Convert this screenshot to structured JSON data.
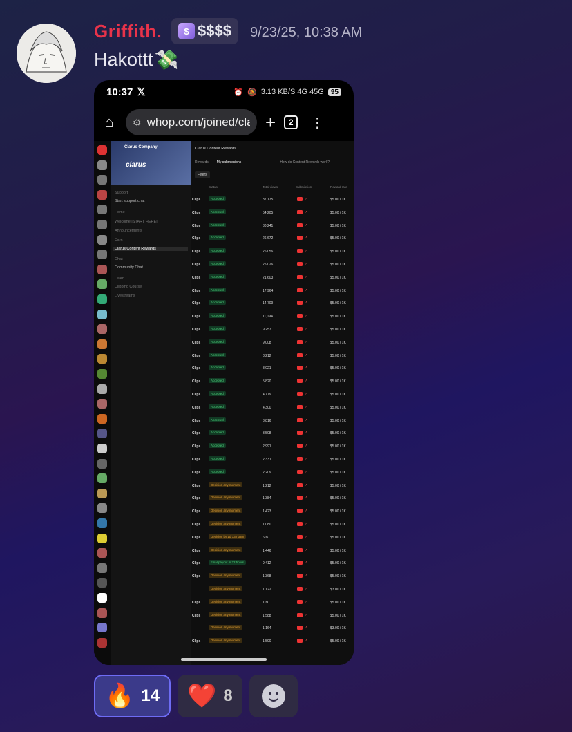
{
  "message": {
    "author": "Griffith.",
    "role_tag": "$$$$",
    "timestamp": "9/23/25, 10:38 AM",
    "text": "Hakottt",
    "text_emoji": "💸"
  },
  "phone": {
    "time": "10:37",
    "status_icons": "3.13 KB/S  4G  45G",
    "battery": "95",
    "url": "whop.com/joined/clar",
    "tab_count": "2"
  },
  "page": {
    "org_name": "Clarus Company",
    "banner_logo": "clarus",
    "title": "Clarus Content Rewards",
    "tabs": [
      "Rewards",
      "My submissions"
    ],
    "tabs_right": "How do Content Rewards work?",
    "filters": "Filters",
    "headers": {
      "status": "Status",
      "views": "Total views",
      "submission": "Submission",
      "rate": "Reward rate"
    },
    "sidebar": [
      {
        "label": "Support",
        "style": "dim"
      },
      {
        "label": "Start support chat",
        "style": ""
      },
      {
        "label": "Home",
        "style": "dim"
      },
      {
        "label": "Welcome [START HERE]",
        "style": "dim"
      },
      {
        "label": "Announcements",
        "style": "dim"
      },
      {
        "label": "Earn",
        "style": "dim"
      },
      {
        "label": "Clarus Content Rewards",
        "style": "active"
      },
      {
        "label": "Chat",
        "style": "dim"
      },
      {
        "label": "Community Chat",
        "style": ""
      },
      {
        "label": "Learn",
        "style": "dim"
      },
      {
        "label": "Clipping Course",
        "style": "dim"
      },
      {
        "label": "Livestreams",
        "style": "dim"
      }
    ],
    "rows": [
      {
        "type": "Clips",
        "status": "Accepted",
        "kind": "accepted",
        "views": "87,175",
        "rate": "$5.00 / 1K"
      },
      {
        "type": "Clips",
        "status": "Accepted",
        "kind": "accepted",
        "views": "54,205",
        "rate": "$5.00 / 1K"
      },
      {
        "type": "Clips",
        "status": "Accepted",
        "kind": "accepted",
        "views": "30,241",
        "rate": "$5.00 / 1K"
      },
      {
        "type": "Clips",
        "status": "Accepted",
        "kind": "accepted",
        "views": "26,672",
        "rate": "$5.00 / 1K"
      },
      {
        "type": "Clips",
        "status": "Accepted",
        "kind": "accepted",
        "views": "26,056",
        "rate": "$5.00 / 1K"
      },
      {
        "type": "Clips",
        "status": "Accepted",
        "kind": "accepted",
        "views": "25,026",
        "rate": "$5.00 / 1K"
      },
      {
        "type": "Clips",
        "status": "Accepted",
        "kind": "accepted",
        "views": "21,603",
        "rate": "$5.00 / 1K"
      },
      {
        "type": "Clips",
        "status": "Accepted",
        "kind": "accepted",
        "views": "17,964",
        "rate": "$5.00 / 1K"
      },
      {
        "type": "Clips",
        "status": "Accepted",
        "kind": "accepted",
        "views": "14,709",
        "rate": "$5.00 / 1K"
      },
      {
        "type": "Clips",
        "status": "Accepted",
        "kind": "accepted",
        "views": "11,194",
        "rate": "$5.00 / 1K"
      },
      {
        "type": "Clips",
        "status": "Accepted",
        "kind": "accepted",
        "views": "9,257",
        "rate": "$5.00 / 1K"
      },
      {
        "type": "Clips",
        "status": "Accepted",
        "kind": "accepted",
        "views": "9,008",
        "rate": "$5.00 / 1K"
      },
      {
        "type": "Clips",
        "status": "Accepted",
        "kind": "accepted",
        "views": "8,212",
        "rate": "$5.00 / 1K"
      },
      {
        "type": "Clips",
        "status": "Accepted",
        "kind": "accepted",
        "views": "8,021",
        "rate": "$5.00 / 1K"
      },
      {
        "type": "Clips",
        "status": "Accepted",
        "kind": "accepted",
        "views": "5,820",
        "rate": "$5.00 / 1K"
      },
      {
        "type": "Clips",
        "status": "Accepted",
        "kind": "accepted",
        "views": "4,779",
        "rate": "$5.00 / 1K"
      },
      {
        "type": "Clips",
        "status": "Accepted",
        "kind": "accepted",
        "views": "4,300",
        "rate": "$5.00 / 1K"
      },
      {
        "type": "Clips",
        "status": "Accepted",
        "kind": "accepted",
        "views": "3,816",
        "rate": "$5.00 / 1K"
      },
      {
        "type": "Clips",
        "status": "Accepted",
        "kind": "accepted",
        "views": "3,508",
        "rate": "$5.00 / 1K"
      },
      {
        "type": "Clips",
        "status": "Accepted",
        "kind": "accepted",
        "views": "2,991",
        "rate": "$5.00 / 1K"
      },
      {
        "type": "Clips",
        "status": "Accepted",
        "kind": "accepted",
        "views": "2,331",
        "rate": "$5.00 / 1K"
      },
      {
        "type": "Clips",
        "status": "Accepted",
        "kind": "accepted",
        "views": "2,209",
        "rate": "$5.00 / 1K"
      },
      {
        "type": "Clips",
        "status": "Decision any moment",
        "kind": "pending",
        "views": "1,212",
        "rate": "$5.00 / 1K"
      },
      {
        "type": "Clips",
        "status": "Decision any moment",
        "kind": "pending",
        "views": "1,384",
        "rate": "$5.00 / 1K"
      },
      {
        "type": "Clips",
        "status": "Decision any moment",
        "kind": "pending",
        "views": "1,423",
        "rate": "$5.00 / 1K"
      },
      {
        "type": "Clips",
        "status": "Decision any moment",
        "kind": "pending",
        "views": "1,080",
        "rate": "$5.00 / 1K"
      },
      {
        "type": "Clips",
        "status": "Decision by 1d 13h 33m",
        "kind": "pending",
        "views": "605",
        "rate": "$5.00 / 1K"
      },
      {
        "type": "Clips",
        "status": "Decision any moment",
        "kind": "pending",
        "views": "1,446",
        "rate": "$5.00 / 1K"
      },
      {
        "type": "Clips",
        "status": "Final payout in 22 hours",
        "kind": "final",
        "views": "9,412",
        "rate": "$5.00 / 1K"
      },
      {
        "type": "Clips",
        "status": "Decision any moment",
        "kind": "pending",
        "views": "1,368",
        "rate": "$5.00 / 1K"
      },
      {
        "type": "",
        "status": "Decision any moment",
        "kind": "pending",
        "views": "1,122",
        "rate": "$3.00 / 1K"
      },
      {
        "type": "Clips",
        "status": "Decision any moment",
        "kind": "pending",
        "views": "109",
        "rate": "$5.00 / 1K"
      },
      {
        "type": "Clips",
        "status": "Decision any moment",
        "kind": "pending",
        "views": "1,588",
        "rate": "$5.00 / 1K"
      },
      {
        "type": "",
        "status": "Decision any moment",
        "kind": "pending",
        "views": "1,164",
        "rate": "$3.00 / 1K"
      },
      {
        "type": "Clips",
        "status": "Decision any moment",
        "kind": "pending",
        "views": "1,590",
        "rate": "$5.00 / 1K"
      }
    ]
  },
  "reactions": [
    {
      "emoji": "🔥",
      "count": "14",
      "active": true
    },
    {
      "emoji": "❤️",
      "count": "8",
      "active": false
    }
  ],
  "colors": {
    "author": "#e8334a",
    "accepted": "#4bd07a",
    "pending": "#e6a234",
    "active_reaction": "#6e6cf5"
  }
}
